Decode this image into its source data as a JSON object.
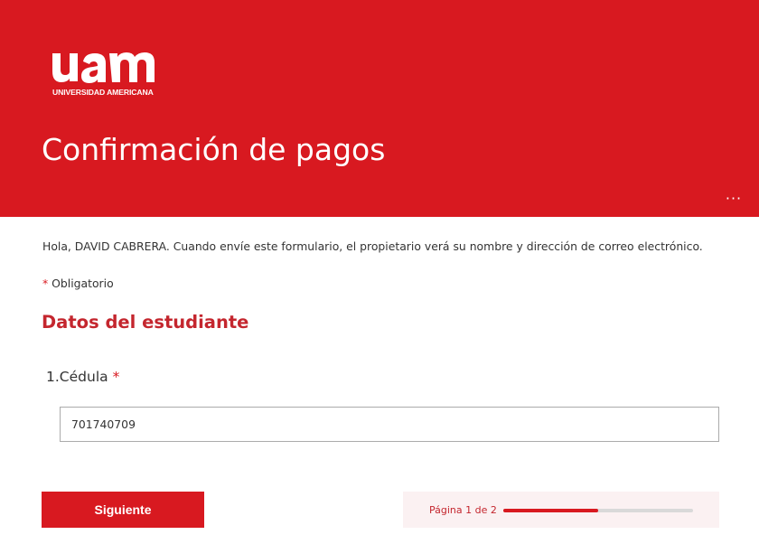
{
  "header": {
    "logo_text": "UNIVERSIDAD AMERICANA",
    "title": "Confirmación de pagos",
    "more_label": "···",
    "background_color": "#d81920"
  },
  "form": {
    "greeting": "Hola, DAVID CABRERA. Cuando envíe este formulario, el propietario verá su nombre y dirección de correo electrónico.",
    "required_marker": "*",
    "required_label": "Obligatorio",
    "section_title": "Datos del estudiante",
    "question": {
      "number": "1.",
      "label": "Cédula",
      "required_marker": "*",
      "value": "701740709"
    }
  },
  "footer": {
    "next_label": "Siguiente",
    "page_text": "Página 1 de 2",
    "progress_fraction": 0.5
  },
  "icons": {
    "more": "more-horizontal-icon",
    "logo": "uam-logo-icon"
  }
}
